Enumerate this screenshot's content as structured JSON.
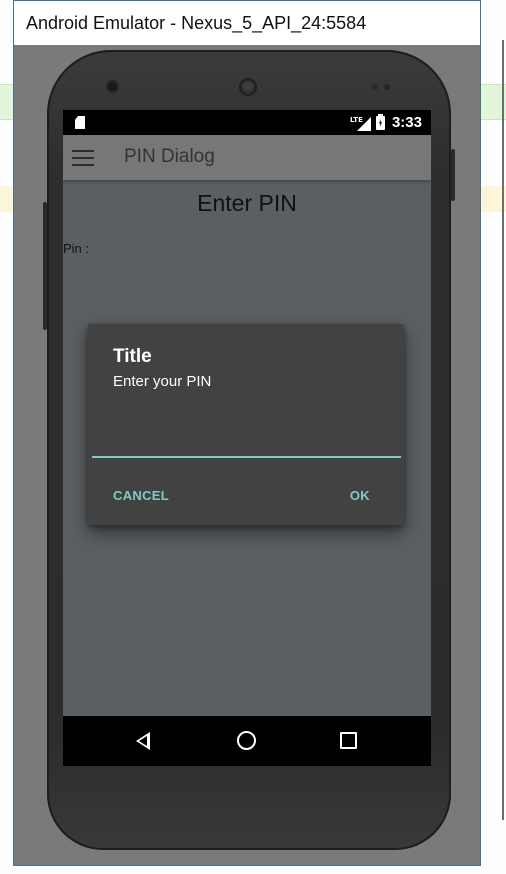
{
  "emulator": {
    "window_title": "Android Emulator - Nexus_5_API_24:5584"
  },
  "status_bar": {
    "network": "LTE",
    "time": "3:33"
  },
  "toolbar": {
    "title": "PIN Dialog",
    "menu_icon": "hamburger-menu-icon"
  },
  "content": {
    "heading": "Enter PIN",
    "pin_label": "Pin :"
  },
  "dialog": {
    "title": "Title",
    "message": "Enter your PIN",
    "input_value": "",
    "cancel_label": "CANCEL",
    "ok_label": "OK",
    "accent_color": "#80cbc4",
    "background_color": "#424242"
  },
  "nav_bar": {
    "back_icon": "back-icon",
    "home_icon": "home-icon",
    "recents_icon": "recents-icon"
  }
}
